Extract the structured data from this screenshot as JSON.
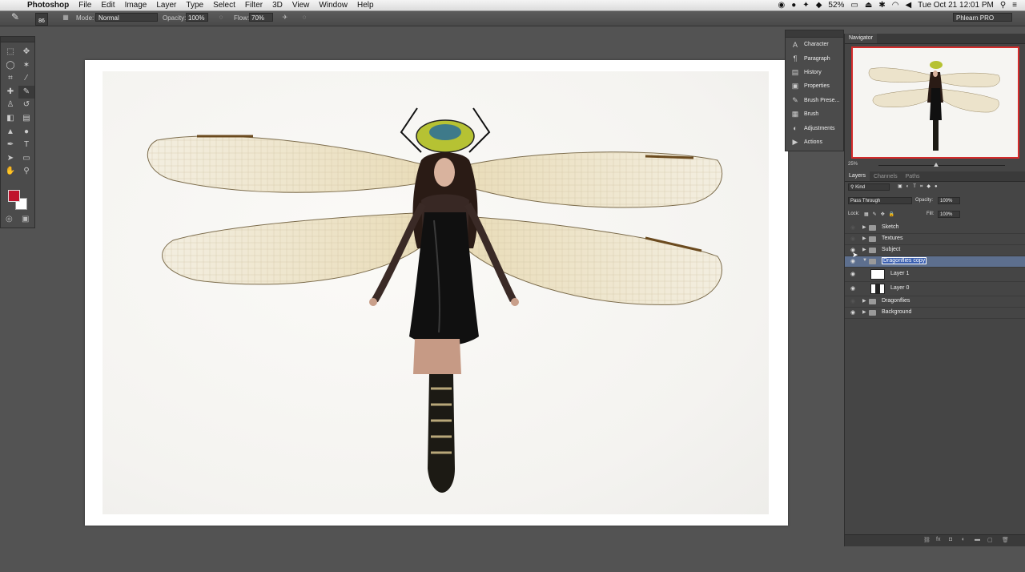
{
  "menubar": {
    "app_name": "Photoshop",
    "items": [
      "File",
      "Edit",
      "Image",
      "Layer",
      "Type",
      "Select",
      "Filter",
      "3D",
      "View",
      "Window",
      "Help"
    ],
    "battery": "52%",
    "clock": "Tue Oct 21  12:01 PM"
  },
  "options": {
    "brush_size": "86",
    "mode_label": "Mode:",
    "mode_value": "Normal",
    "opacity_label": "Opacity:",
    "opacity_value": "100%",
    "flow_label": "Flow:",
    "flow_value": "70%",
    "workspace": "Phlearn PRO"
  },
  "colors": {
    "foreground": "#c0132c",
    "background": "#ffffff",
    "selection": "#5d6f8e",
    "navigator_frame": "#d52b2b"
  },
  "dock": {
    "items": [
      {
        "icon": "character-icon",
        "label": "Character"
      },
      {
        "icon": "paragraph-icon",
        "label": "Paragraph"
      },
      {
        "icon": "history-icon",
        "label": "History"
      },
      {
        "icon": "properties-icon",
        "label": "Properties"
      },
      {
        "icon": "brush-presets-icon",
        "label": "Brush Prese..."
      },
      {
        "icon": "brush-icon",
        "label": "Brush"
      },
      {
        "icon": "adjustments-icon",
        "label": "Adjustments"
      },
      {
        "icon": "actions-icon",
        "label": "Actions"
      }
    ]
  },
  "navigator": {
    "title": "Navigator",
    "zoom": "25%"
  },
  "layers_panel": {
    "tabs": [
      "Layers",
      "Channels",
      "Paths"
    ],
    "filter": "Kind",
    "blend_mode": "Pass Through",
    "opacity_label": "Opacity:",
    "opacity_value": "100%",
    "lock_label": "Lock:",
    "fill_label": "Fill:",
    "fill_value": "100%",
    "layers": [
      {
        "name": "Sketch",
        "type": "group",
        "visible": false
      },
      {
        "name": "Textures",
        "type": "group",
        "visible": false
      },
      {
        "name": "Subject",
        "type": "group",
        "visible": true
      },
      {
        "name": "Dragonflies copy",
        "type": "group",
        "visible": true,
        "selected": true,
        "expanded": true
      },
      {
        "name": "Layer 1",
        "type": "layer",
        "visible": true
      },
      {
        "name": "Layer 0",
        "type": "layer",
        "visible": true
      },
      {
        "name": "Dragonflies",
        "type": "group",
        "visible": false
      },
      {
        "name": "Background",
        "type": "group",
        "visible": true
      }
    ]
  }
}
